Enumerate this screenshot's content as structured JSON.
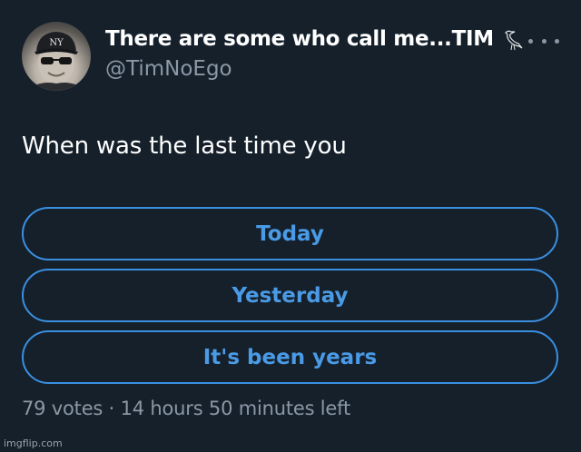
{
  "tweet": {
    "author": {
      "display_name": "There are some who call me...TIM",
      "handle": "@TimNoEgo",
      "name_emoji_icon": "heron-bird-icon",
      "avatar_icon": "profile-photo-man-with-cap-sunglasses"
    },
    "more_icon": "more-horizontal-icon",
    "text": "When was the last time you",
    "poll": {
      "options": [
        {
          "label": "Today"
        },
        {
          "label": "Yesterday"
        },
        {
          "label": "It's been years"
        }
      ],
      "meta": "79 votes · 14 hours 50 minutes left"
    }
  },
  "watermark": "imgflip.com",
  "colors": {
    "background": "#15202b",
    "text_primary": "#ffffff",
    "text_secondary": "#8b98a5",
    "poll_accent": "#4a9ae6",
    "poll_border": "#3a8fe0"
  }
}
